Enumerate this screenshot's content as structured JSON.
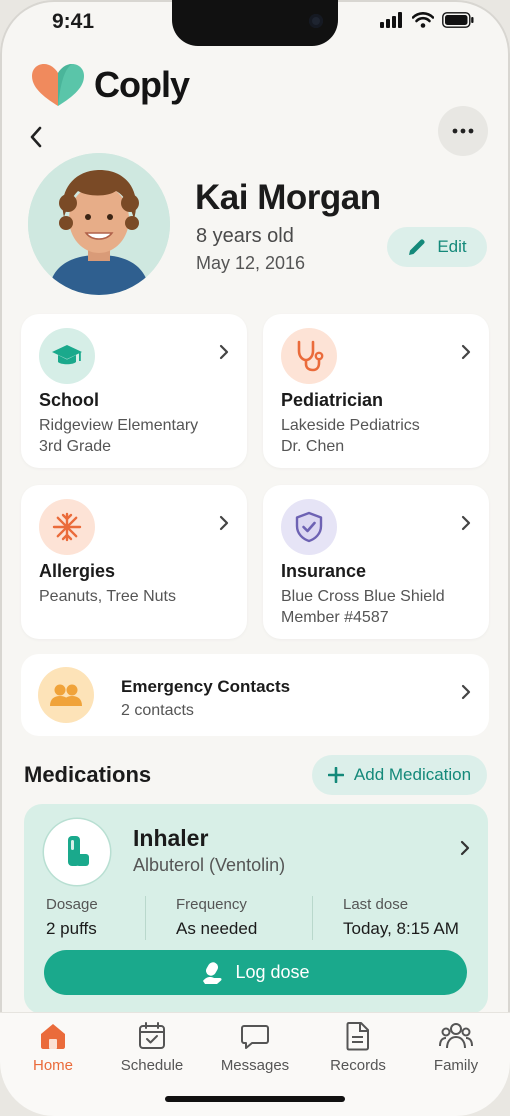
{
  "status_bar": {
    "time": "9:41"
  },
  "brand": {
    "name": "Coply"
  },
  "profile": {
    "name": "Kai Morgan",
    "age": "8 years old",
    "dob": "May 12, 2016",
    "edit_label": "Edit"
  },
  "cards": [
    {
      "title": "School",
      "line1": "Ridgeview Elementary",
      "line2": "3rd Grade"
    },
    {
      "title": "Pediatrician",
      "line1": "Lakeside Pediatrics",
      "line2": "Dr. Chen"
    },
    {
      "title": "Allergies",
      "line1": "Peanuts, Tree Nuts",
      "line2": ""
    },
    {
      "title": "Insurance",
      "line1": "Blue Cross Blue Shield",
      "line2": "Member #4587"
    }
  ],
  "emergency": {
    "title": "Emergency Contacts",
    "subtitle": "2 contacts"
  },
  "medications": {
    "section_title": "Medications",
    "add_label": "Add Medication",
    "item": {
      "name": "Inhaler",
      "generic": "Albuterol (Ventolin)",
      "stats": [
        {
          "label": "Dosage",
          "value": "2 puffs"
        },
        {
          "label": "Frequency",
          "value": "As needed"
        },
        {
          "label": "Last dose",
          "value": "Today, 8:15 AM"
        }
      ],
      "log_label": "Log dose"
    }
  },
  "tabs": [
    {
      "label": "Home",
      "icon": "home-icon",
      "active": true
    },
    {
      "label": "Schedule",
      "icon": "calendar-icon",
      "active": false
    },
    {
      "label": "Messages",
      "icon": "message-icon",
      "active": false
    },
    {
      "label": "Records",
      "icon": "document-icon",
      "active": false
    },
    {
      "label": "Family",
      "icon": "family-icon",
      "active": false
    }
  ],
  "colors": {
    "accent": "#1aa98c",
    "active_tab": "#ea6b3b",
    "background": "#f7f6f3"
  }
}
